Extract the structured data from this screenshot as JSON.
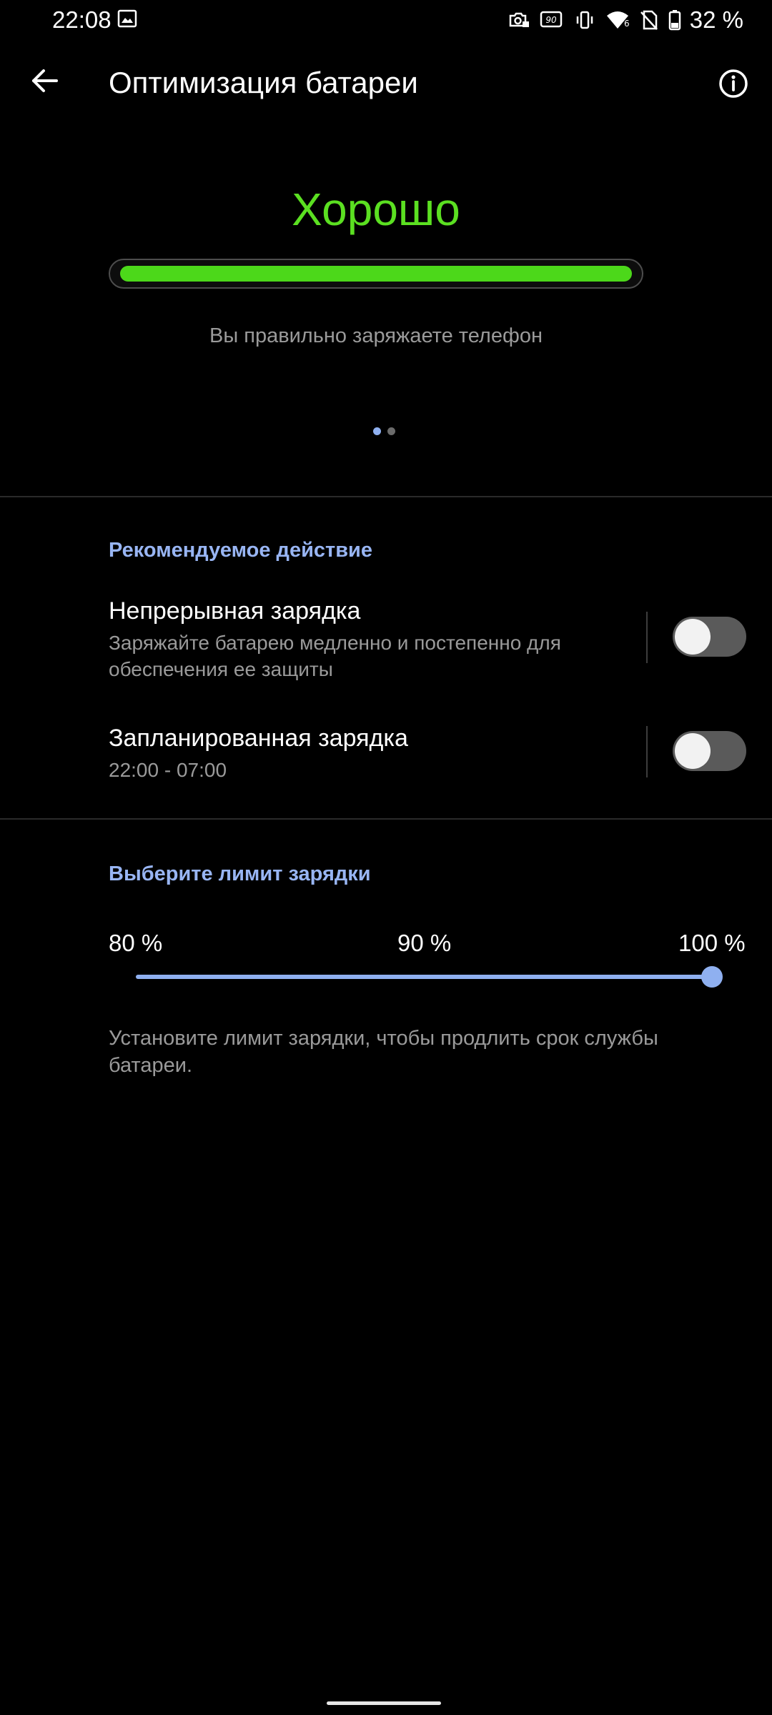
{
  "status_bar": {
    "time": "22:08",
    "battery_percent": "32 %",
    "icons": [
      "image-icon",
      "camera-lock-icon",
      "refresh-90hz-icon",
      "vibrate-icon",
      "wifi-icon",
      "no-sim-icon",
      "battery-icon"
    ]
  },
  "app_bar": {
    "title": "Оптимизация батареи",
    "back_icon": "arrow-left-icon",
    "info_icon": "info-icon"
  },
  "battery_status": {
    "label": "Хорошо",
    "description": "Вы правильно заряжаете телефон",
    "health_level": 1.0,
    "color": "#5be021",
    "pages": 2,
    "active_page": 0
  },
  "recommended": {
    "title": "Рекомендуемое действие",
    "items": [
      {
        "title": "Непрерывная зарядка",
        "subtitle": "Заряжайте батарею медленно и постепенно для обеспечения ее защиты",
        "enabled": false
      },
      {
        "title": "Запланированная зарядка",
        "subtitle": "22:00 - 07:00",
        "enabled": false
      }
    ]
  },
  "charge_limit": {
    "title": "Выберите лимит зарядки",
    "options": [
      "80 %",
      "90 %",
      "100 %"
    ],
    "selected": "100 %",
    "hint": "Установите лимит зарядки, чтобы продлить срок службы батареи."
  },
  "colors": {
    "accent": "#8fb0f0",
    "good": "#5be021",
    "background": "#000000"
  }
}
